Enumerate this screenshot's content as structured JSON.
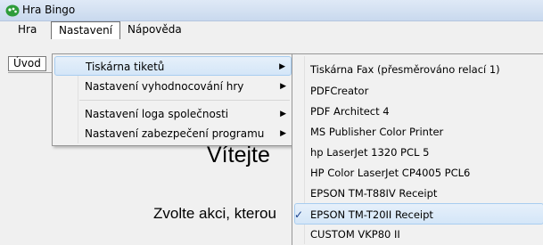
{
  "window": {
    "title": "Hra Bingo",
    "icon": "bingo-app-icon"
  },
  "menubar": [
    {
      "label": "Hra"
    },
    {
      "label": "Nastavení",
      "active": true
    },
    {
      "label": "Nápověda"
    }
  ],
  "content": {
    "tab_label": "Úvod",
    "welcome_text": "Vítejte",
    "prompt_text": "Zvolte akci, kterou"
  },
  "settings_menu": {
    "items": [
      {
        "label": "Tiskárna tiketů",
        "has_submenu": true,
        "highlighted": true
      },
      {
        "label": "Nastavení vyhodnocování hry",
        "has_submenu": true
      },
      {
        "label": "Nastavení loga společnosti",
        "has_submenu": true
      },
      {
        "label": "Nastavení zabezpečení programu",
        "has_submenu": true
      }
    ]
  },
  "printer_submenu": {
    "items": [
      {
        "label": "Tiskárna Fax (přesměrováno relací 1)"
      },
      {
        "label": "PDFCreator"
      },
      {
        "label": "PDF Architect 4"
      },
      {
        "label": "MS Publisher Color Printer"
      },
      {
        "label": "hp LaserJet 1320 PCL 5"
      },
      {
        "label": "HP Color LaserJet CP4005 PCL6"
      },
      {
        "label": "EPSON TM-T88IV Receipt"
      },
      {
        "label": "EPSON TM-T20II Receipt",
        "checked": true
      },
      {
        "label": "CUSTOM VKP80 II"
      }
    ],
    "check_mark": "✓"
  },
  "colors": {
    "highlight": "#d4e6f8",
    "highlight_border": "#a8cdf0",
    "menu_bg": "#f1f1f1"
  }
}
